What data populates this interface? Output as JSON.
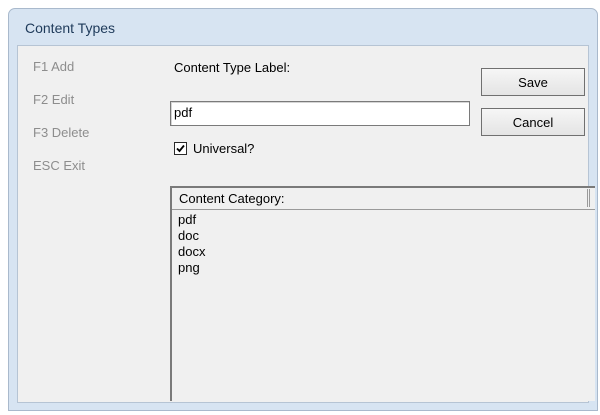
{
  "window": {
    "title": "Content Types"
  },
  "fkeys": {
    "add": "F1 Add",
    "edit": "F2 Edit",
    "delete": "F3 Delete",
    "exit": "ESC Exit"
  },
  "form": {
    "label_text": "Content Type Label:",
    "label_value": "pdf",
    "universal_label": "Universal?",
    "universal_checked": true
  },
  "buttons": {
    "save": "Save",
    "cancel": "Cancel"
  },
  "list": {
    "header": "Content Category:",
    "items": [
      "pdf",
      "doc",
      "docx",
      "png"
    ]
  },
  "icons": {
    "checkbox": "checkmark-icon"
  }
}
